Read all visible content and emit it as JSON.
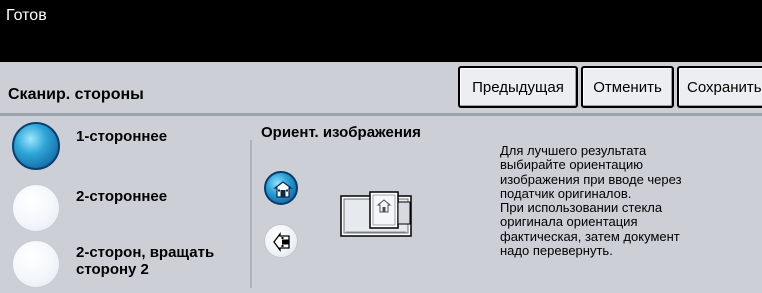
{
  "status": {
    "text": "Готов"
  },
  "header": {
    "title": "Сканир. стороны",
    "buttons": {
      "previous": "Предыдущая",
      "cancel": "Отменить",
      "save": "Сохранить"
    }
  },
  "options": {
    "items": [
      {
        "label": "1-стороннее",
        "selected": true
      },
      {
        "label": "2-стороннее",
        "selected": false
      },
      {
        "label": "2-сторон, вращать сторону 2",
        "selected": false
      }
    ]
  },
  "orientation": {
    "title": "Ориент. изображения",
    "options": [
      {
        "icon": "portrait-orientation-icon",
        "selected": true
      },
      {
        "icon": "landscape-orientation-icon",
        "selected": false
      }
    ]
  },
  "help": {
    "text": "Для лучшего результата\nвыбирайте ориентацию\nизображения при вводе через\nподатчик оригиналов.\nПри использовании стекла\nоригинала ориентация\nфактическая, затем документ\nнадо перевернуть."
  },
  "colors": {
    "status_bar": "#000000",
    "panel": "#ccd0d6",
    "accent": "#2a9fd6"
  }
}
